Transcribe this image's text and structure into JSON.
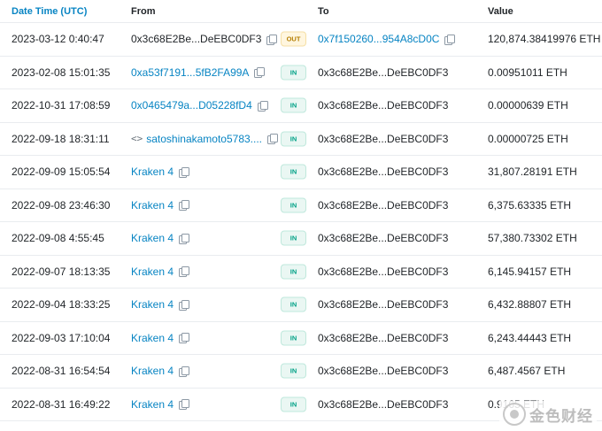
{
  "header": {
    "date": "Date Time (UTC)",
    "from": "From",
    "to": "To",
    "value": "Value"
  },
  "rows": [
    {
      "date": "2023-03-12 0:40:47",
      "from": "0x3c68E2Be...DeEBC0DF3",
      "from_link": false,
      "dir": "OUT",
      "to": "0x7f150260...954A8cD0C",
      "to_link": true,
      "value": "120,874.38419976 ETH"
    },
    {
      "date": "2023-02-08 15:01:35",
      "from": "0xa53f7191...5fB2FA99A",
      "from_link": true,
      "dir": "IN",
      "to": "0x3c68E2Be...DeEBC0DF3",
      "to_link": false,
      "value": "0.00951011 ETH"
    },
    {
      "date": "2022-10-31 17:08:59",
      "from": "0x0465479a...D05228fD4",
      "from_link": true,
      "dir": "IN",
      "to": "0x3c68E2Be...DeEBC0DF3",
      "to_link": false,
      "value": "0.00000639 ETH"
    },
    {
      "date": "2022-09-18 18:31:11",
      "from": "satoshinakamoto5783....",
      "from_link": true,
      "contract": true,
      "dir": "IN",
      "to": "0x3c68E2Be...DeEBC0DF3",
      "to_link": false,
      "value": "0.00000725 ETH"
    },
    {
      "date": "2022-09-09 15:05:54",
      "from": "Kraken 4",
      "from_link": true,
      "dir": "IN",
      "to": "0x3c68E2Be...DeEBC0DF3",
      "to_link": false,
      "value": "31,807.28191 ETH"
    },
    {
      "date": "2022-09-08 23:46:30",
      "from": "Kraken 4",
      "from_link": true,
      "dir": "IN",
      "to": "0x3c68E2Be...DeEBC0DF3",
      "to_link": false,
      "value": "6,375.63335 ETH"
    },
    {
      "date": "2022-09-08 4:55:45",
      "from": "Kraken 4",
      "from_link": true,
      "dir": "IN",
      "to": "0x3c68E2Be...DeEBC0DF3",
      "to_link": false,
      "value": "57,380.73302 ETH"
    },
    {
      "date": "2022-09-07 18:13:35",
      "from": "Kraken 4",
      "from_link": true,
      "dir": "IN",
      "to": "0x3c68E2Be...DeEBC0DF3",
      "to_link": false,
      "value": "6,145.94157 ETH"
    },
    {
      "date": "2022-09-04 18:33:25",
      "from": "Kraken 4",
      "from_link": true,
      "dir": "IN",
      "to": "0x3c68E2Be...DeEBC0DF3",
      "to_link": false,
      "value": "6,432.88807 ETH"
    },
    {
      "date": "2022-09-03 17:10:04",
      "from": "Kraken 4",
      "from_link": true,
      "dir": "IN",
      "to": "0x3c68E2Be...DeEBC0DF3",
      "to_link": false,
      "value": "6,243.44443 ETH"
    },
    {
      "date": "2022-08-31 16:54:54",
      "from": "Kraken 4",
      "from_link": true,
      "dir": "IN",
      "to": "0x3c68E2Be...DeEBC0DF3",
      "to_link": false,
      "value": "6,487.4567 ETH"
    },
    {
      "date": "2022-08-31 16:49:22",
      "from": "Kraken 4",
      "from_link": true,
      "dir": "IN",
      "to": "0x3c68E2Be...DeEBC0DF3",
      "to_link": false,
      "value": "0.9165 ETH"
    }
  ],
  "watermark": "金色财经",
  "colors": {
    "link": "#0784c3",
    "in_badge": "#00a186",
    "out_badge": "#b47d00"
  }
}
